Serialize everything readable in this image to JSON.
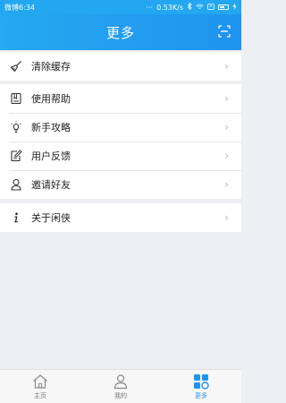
{
  "status_bar": {
    "carrier_time": "微博6:34",
    "network_speed": "0.53K/s",
    "indicators": "···",
    "icons": [
      "bluetooth-icon",
      "wifi-icon",
      "sim-icon",
      "battery-icon",
      "charging-icon"
    ]
  },
  "header": {
    "title": "更多",
    "scan_icon": "scan-icon"
  },
  "menu_groups": [
    {
      "items": [
        {
          "label": "清除缓存",
          "icon": "broom-icon"
        }
      ]
    },
    {
      "items": [
        {
          "label": "使用帮助",
          "icon": "book-icon"
        },
        {
          "label": "新手攻略",
          "icon": "lightbulb-icon"
        },
        {
          "label": "用户反馈",
          "icon": "feedback-icon"
        },
        {
          "label": "邀请好友",
          "icon": "user-icon"
        }
      ]
    },
    {
      "items": [
        {
          "label": "关于闲侠",
          "icon": "info-icon"
        }
      ]
    }
  ],
  "tab_bar": {
    "tabs": [
      {
        "label": "主页",
        "icon": "home-icon",
        "active": false
      },
      {
        "label": "我的",
        "icon": "person-icon",
        "active": false
      },
      {
        "label": "更多",
        "icon": "grid-icon",
        "active": true
      }
    ]
  },
  "colors": {
    "primary": "#1f94ef",
    "background": "#eeeff2",
    "row_text": "#222222",
    "chevron": "#b7b7b7"
  }
}
